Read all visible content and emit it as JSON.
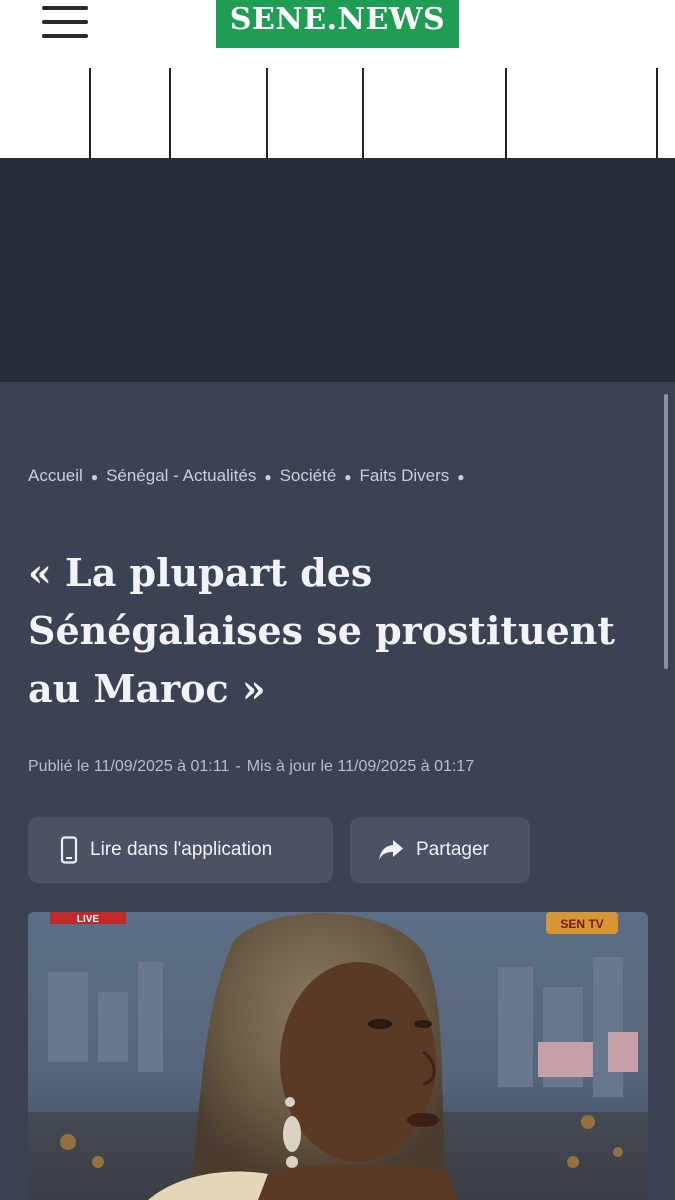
{
  "header": {
    "logo_text": "SENE.NEWS",
    "brand_color": "#1f9d55",
    "menu_icon": "hamburger-menu-icon"
  },
  "breadcrumb": {
    "items": [
      "Accueil",
      "Sénégal - Actualités",
      "Société",
      "Faits Divers"
    ]
  },
  "article": {
    "title": "« La plupart des Sénégalaises se prostituent au Maroc »",
    "published": "Publié le 11/09/2025 à 01:11",
    "separator": "-",
    "updated": "Mis à jour le 11/09/2025 à 01:17",
    "background_color": "#3a4253"
  },
  "actions": {
    "read_in_app_label": "Lire dans l'application",
    "read_in_app_icon": "smartphone-icon",
    "share_label": "Partager",
    "share_icon": "share-arrow-icon"
  },
  "photo": {
    "live_badge": "LIVE",
    "channel_logo": "SEN TV"
  }
}
